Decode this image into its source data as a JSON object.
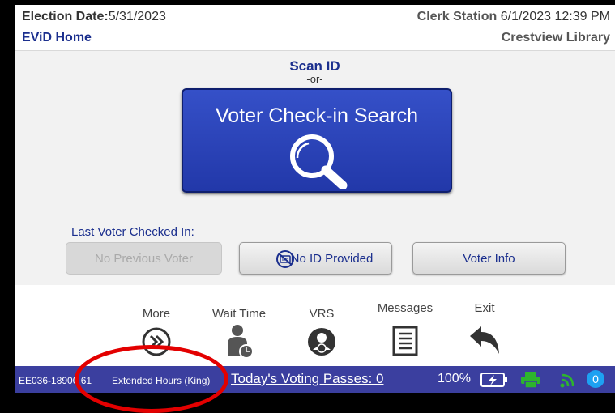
{
  "header": {
    "election_date_label": "Election Date:",
    "election_date_value": "5/31/2023",
    "home_title": "EViD Home",
    "station_label": "Clerk Station",
    "datetime": "6/1/2023 12:39 PM",
    "location": "Crestview Library"
  },
  "main": {
    "scan_id": "Scan ID",
    "or_text": "-or-",
    "search_button_label": "Voter Check-in Search",
    "last_voter_label": "Last Voter Checked In:",
    "no_previous_voter": "No Previous Voter",
    "no_id_provided": "No ID Provided",
    "voter_info": "Voter Info"
  },
  "toolbar": {
    "more": "More",
    "wait_time": "Wait Time",
    "vrs": "VRS",
    "messages": "Messages",
    "exit": "Exit"
  },
  "statusbar": {
    "device_id": "EE036-18900 61",
    "extended_hours": "Extended Hours (King)",
    "voting_passes": "Today's Voting Passes: 0",
    "battery_percent": "100%",
    "notification_count": "0"
  },
  "colors": {
    "brand_blue": "#1b2f8e",
    "button_blue": "#2b43b8",
    "status_bar": "#3b3f9f",
    "printer_green": "#2db52d",
    "annotation_red": "#e30000"
  },
  "icons": [
    "magnifier-icon",
    "no-id-icon",
    "more-chevrons-icon",
    "wait-time-person-icon",
    "vrs-user-icon",
    "messages-list-icon",
    "exit-back-arrow-icon",
    "battery-charging-icon",
    "printer-icon",
    "wifi-signal-icon"
  ]
}
